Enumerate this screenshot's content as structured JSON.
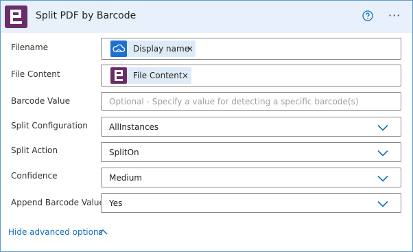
{
  "header": {
    "title": "Split PDF by Barcode",
    "help_icon": "help-circle-icon",
    "more_icon": "more-ellipsis-icon",
    "more_label": "···"
  },
  "fields": {
    "filename": {
      "label": "Filename",
      "token": "Display name",
      "token_icon": "onedrive-cloud-icon"
    },
    "file_content": {
      "label": "File Content",
      "token": "File Content",
      "token_icon": "plumsail-logo-icon"
    },
    "barcode_value": {
      "label": "Barcode Value",
      "placeholder": "Optional - Specify a value for detecting a specific barcode(s)"
    },
    "split_configuration": {
      "label": "Split Configuration",
      "value": "AllInstances"
    },
    "split_action": {
      "label": "Split Action",
      "value": "SplitOn"
    },
    "confidence": {
      "label": "Confidence",
      "value": "Medium"
    },
    "append_barcode_value": {
      "label": "Append Barcode Value",
      "value": "Yes"
    }
  },
  "footer": {
    "hide_advanced_label": "Hide advanced options"
  },
  "colors": {
    "brand": "#6b2d69",
    "accent": "#0f6cbd",
    "header_bg": "#e8f1fb",
    "token_bg": "#dfeaf7",
    "onedrive": "#1f6fd1"
  },
  "remove_glyph": "×"
}
